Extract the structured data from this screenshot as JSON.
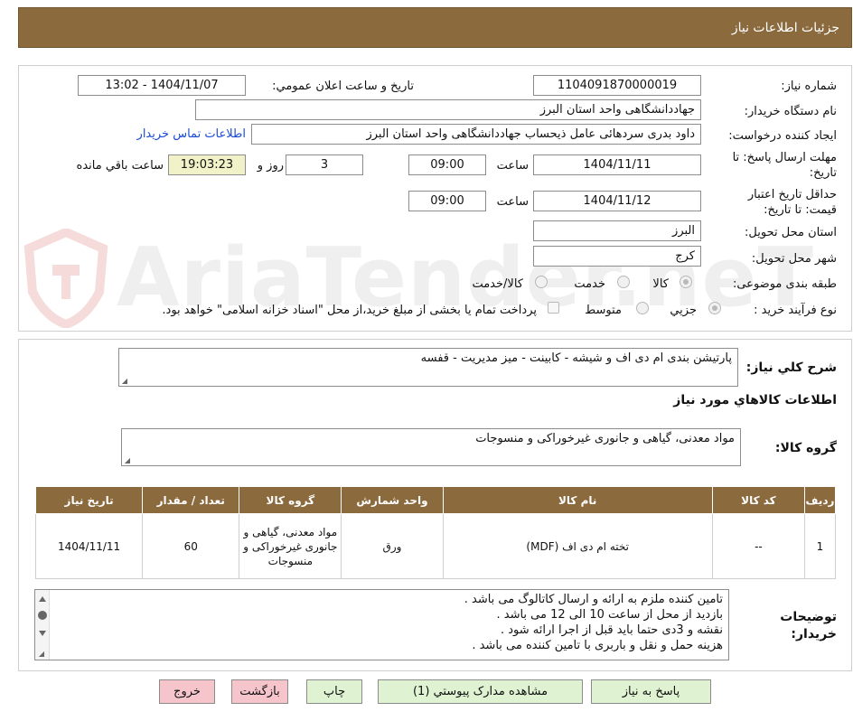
{
  "header": {
    "title": "جزئیات اطلاعات نیاز"
  },
  "watermark": {
    "text": "AriaTender.neT",
    "icon": "aria-logo-icon"
  },
  "form": {
    "need_number_label": "شماره نیاز:",
    "need_number": "1104091870000019",
    "announce_label": "تاریخ و ساعت اعلان عمومي:",
    "announce_value": "1404/11/07 - 13:02",
    "buyer_org_label": "نام دستگاه خریدار:",
    "buyer_org": "جهاددانشگاهی واحد استان البرز",
    "requester_label": "ایجاد کننده درخواست:",
    "requester": "داود بدری سردهائی عامل ذیحساب جهاددانشگاهی واحد استان البرز",
    "contact_link": "اطلاعات تماس خریدار",
    "deadline_label": "مهلت ارسال پاسخ: تا تاریخ:",
    "deadline_date": "1404/11/11",
    "time_label": "ساعت",
    "deadline_time": "09:00",
    "days_value": "3",
    "days_label": "روز و",
    "remaining_time": "19:03:23",
    "remaining_label": "ساعت باقي مانده",
    "validity_label": "حداقل تاریخ اعتبار قیمت: تا تاریخ:",
    "validity_date": "1404/11/12",
    "validity_time": "09:00",
    "province_label": "استان محل تحویل:",
    "province": "البرز",
    "city_label": "شهر محل تحویل:",
    "city": "کرج",
    "category_label": "طبقه بندی موضوعی:",
    "category_options": [
      "کالا",
      "خدمت",
      "کالا/خدمت"
    ],
    "process_label": "نوع فرآیند خرید :",
    "process_options": [
      "جزیي",
      "متوسط"
    ],
    "payment_note": "پرداخت تمام یا بخشی از مبلغ خرید،از محل \"اسناد خزانه اسلامی\" خواهد بود."
  },
  "summary": {
    "desc_label": "شرح کلي نیاز:",
    "desc": "پارتیشن بندی ام دی اف و شیشه - کابینت - میز مدیریت - قفسه",
    "goods_info_title": "اطلاعات کالاهاي مورد نیاز",
    "group_label": "گروه کالا:",
    "group_value": "مواد معدنی، گیاهی و جانوری غیرخوراکی و منسوجات"
  },
  "table": {
    "headers": [
      "ردیف",
      "کد کالا",
      "نام کالا",
      "واحد شمارش",
      "گروه کالا",
      "تعداد / مقدار",
      "تاریخ نیاز"
    ],
    "row": {
      "index": "1",
      "code": "--",
      "name": "تخته ام دی اف (MDF)",
      "unit": "ورق",
      "group": "مواد معدنی، گیاهی و جانوری غیرخوراکی و منسوجات",
      "qty": "60",
      "date": "1404/11/11"
    }
  },
  "notes": {
    "label": "توضیحات خریدار:",
    "lines": [
      "تامین کننده ملزم به ارائه و ارسال کاتالوگ می باشد .",
      "بازدید از محل از ساعت 10 الی 12 می باشد .",
      "نقشه و 3دی حتما باید قبل از اجرا ارائه شود .",
      "هزینه حمل و نقل و باربری با تامین کننده می باشد ."
    ]
  },
  "buttons": {
    "reply": "پاسخ به نیاز",
    "attachments": "مشاهده مدارک پیوستي (1)",
    "print": "چاپ",
    "back": "بازگشت",
    "exit": "خروج"
  },
  "colors": {
    "header_bg": "#8b6a3e",
    "button_green": "#dff2d2",
    "button_pink": "#f5c5cb",
    "link": "#1a4bd6",
    "highlight": "#f2f2c8"
  }
}
